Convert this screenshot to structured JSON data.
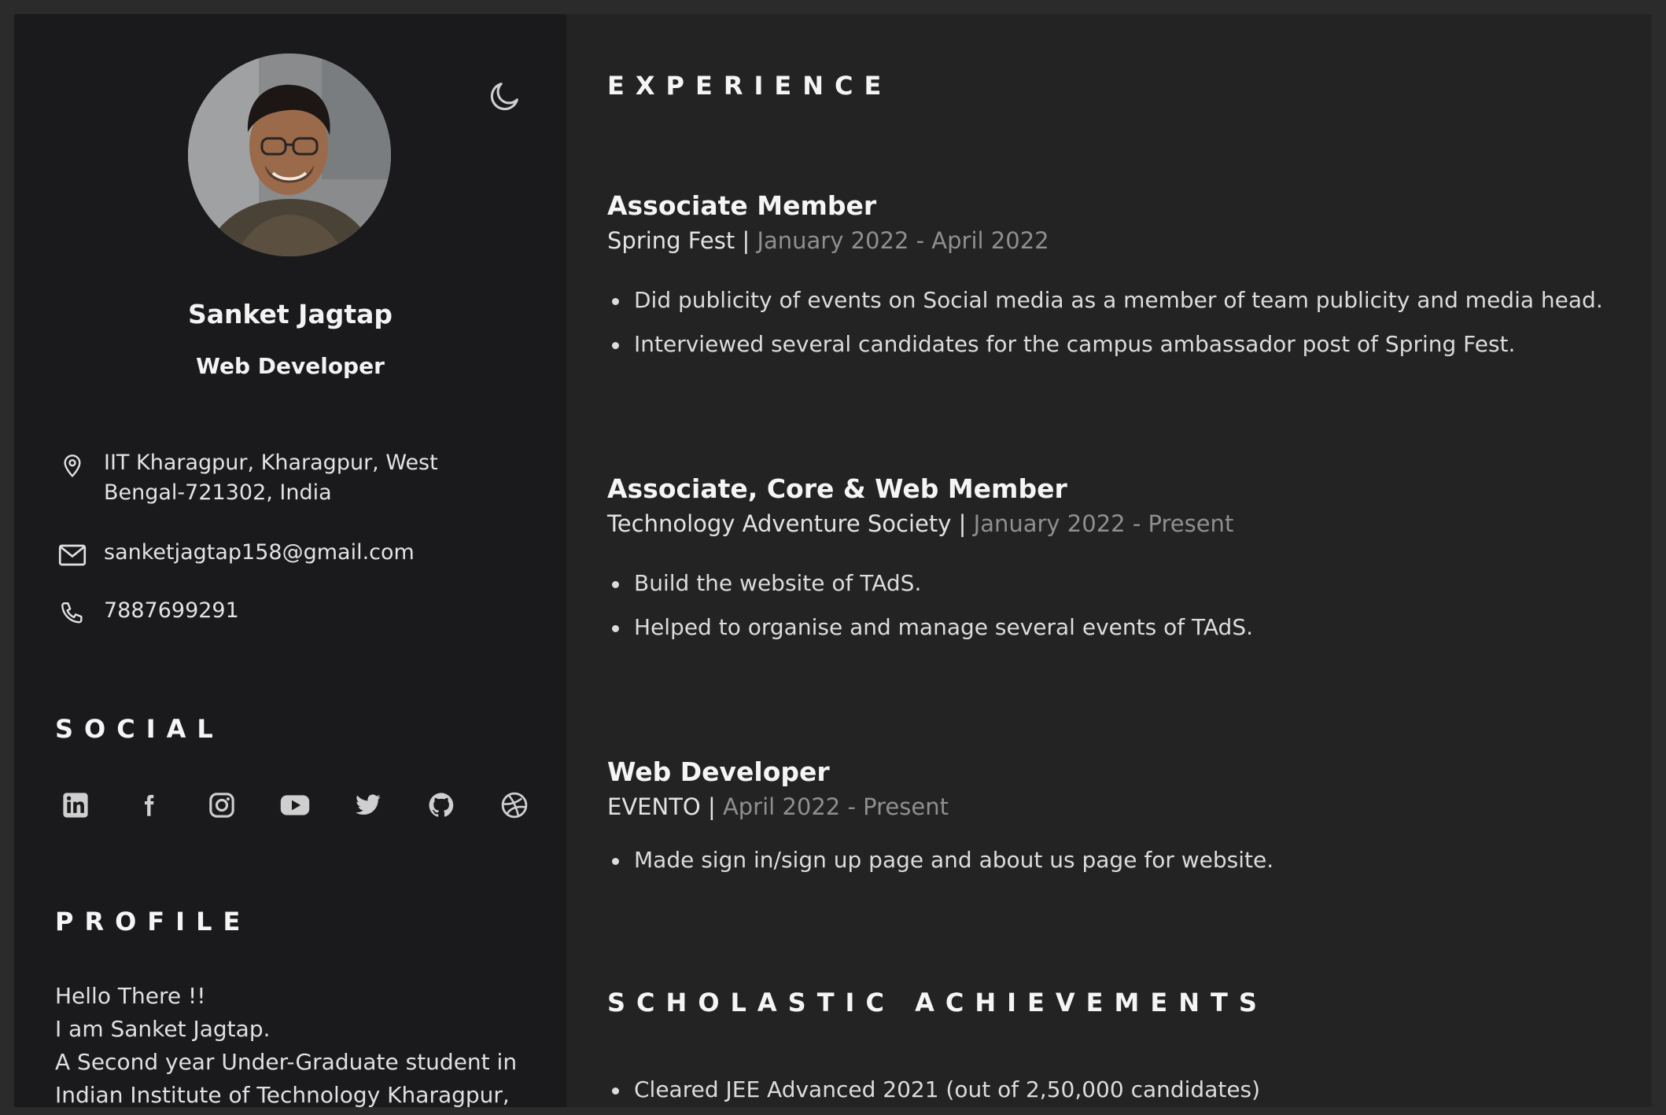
{
  "sidebar": {
    "name": "Sanket Jagtap",
    "role": "Web Developer",
    "theme_toggle_icon": "moon-icon",
    "contact": {
      "location": "IIT Kharagpur, Kharagpur, West Bengal-721302, India",
      "email": "sanketjagtap158@gmail.com",
      "phone": "7887699291"
    },
    "social_title": "SOCIAL",
    "social_icons": [
      "linkedin-icon",
      "facebook-icon",
      "instagram-icon",
      "youtube-icon",
      "twitter-icon",
      "github-icon",
      "dribbble-icon"
    ],
    "profile_title": "PROFILE",
    "profile_lines": [
      "Hello There !!",
      "I am Sanket Jagtap.",
      "A Second year Under-Graduate student in",
      "Indian Institute of Technology Kharagpur,"
    ]
  },
  "main": {
    "experience_title": "EXPERIENCE",
    "jobs": [
      {
        "title": "Associate Member",
        "org": "Spring Fest",
        "separator": "|",
        "date": "January 2022 - April 2022",
        "bullets": [
          "Did publicity of events on Social media as a member of team publicity and media head.",
          "Interviewed several candidates for the campus ambassador post of Spring Fest."
        ]
      },
      {
        "title": "Associate, Core & Web Member",
        "org": "Technology Adventure Society",
        "separator": "|",
        "date": "January 2022 - Present",
        "bullets": [
          "Build the website of TAdS.",
          "Helped to organise and manage several events of TAdS."
        ]
      },
      {
        "title": "Web Developer",
        "org": "EVENTO",
        "separator": "|",
        "date": "April 2022 - Present",
        "bullets": [
          "Made sign in/sign up page and about us page for website."
        ]
      }
    ],
    "scholastic_title": "SCHOLASTIC ACHIEVEMENTS",
    "scholastic_items": [
      "Cleared JEE Advanced 2021 (out of 2,50,000 candidates)"
    ]
  }
}
